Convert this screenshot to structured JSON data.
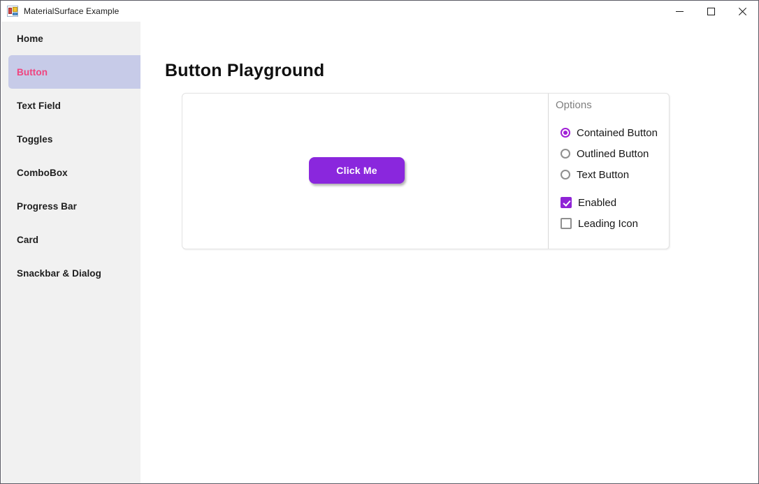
{
  "window": {
    "title": "MaterialSurface Example",
    "icon": "winforms-app-icon",
    "controls": [
      {
        "name": "minimize-button",
        "glyph": "minimize-icon"
      },
      {
        "name": "maximize-button",
        "glyph": "maximize-icon"
      },
      {
        "name": "close-button",
        "glyph": "close-icon"
      }
    ]
  },
  "sidebar": {
    "selected_index": 1,
    "selected_bg": "#c7cbe8",
    "selected_fg": "#f0447f",
    "items": [
      {
        "label": "Home"
      },
      {
        "label": "Button"
      },
      {
        "label": "Text Field"
      },
      {
        "label": "Toggles"
      },
      {
        "label": "ComboBox"
      },
      {
        "label": "Progress Bar"
      },
      {
        "label": "Card"
      },
      {
        "label": "Snackbar & Dialog"
      }
    ]
  },
  "main": {
    "page_title": "Button Playground",
    "demo": {
      "button_label": "Click Me",
      "button_color": "#8a27dd",
      "button_text_color": "#ffffff"
    },
    "options": {
      "title": "Options",
      "accent_color": "#a01fd6",
      "radios": [
        {
          "label": "Contained Button",
          "checked": true
        },
        {
          "label": "Outlined Button",
          "checked": false
        },
        {
          "label": "Text Button",
          "checked": false
        }
      ],
      "checkboxes": [
        {
          "label": "Enabled",
          "checked": true
        },
        {
          "label": "Leading Icon",
          "checked": false
        }
      ]
    }
  }
}
